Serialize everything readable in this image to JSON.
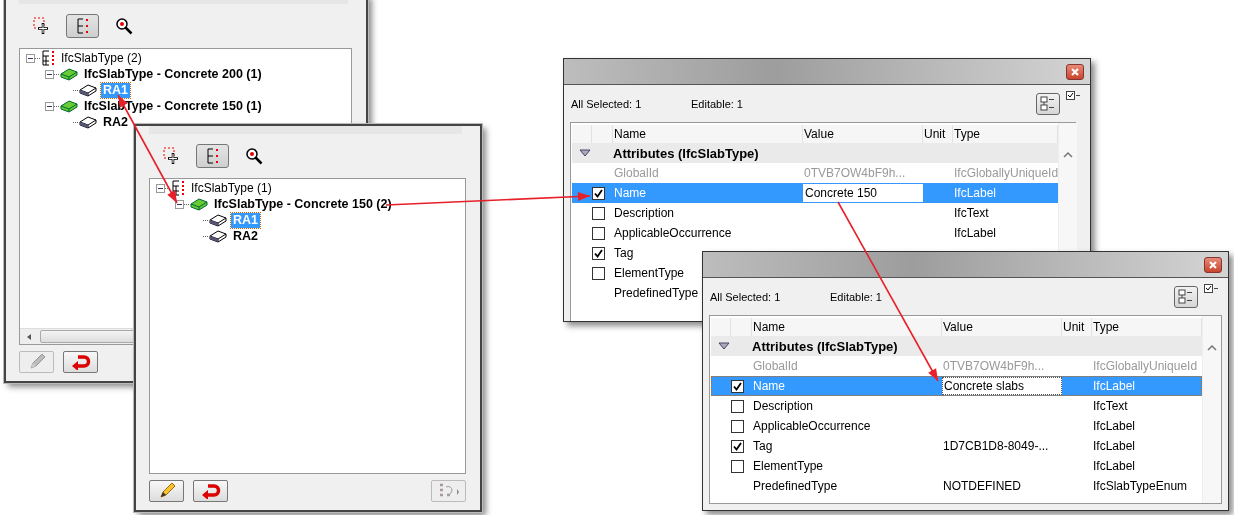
{
  "tree_panels": [
    {
      "toolbar": [
        {
          "kind": "select",
          "selected": false
        },
        {
          "kind": "tree",
          "selected": true
        },
        {
          "kind": "find",
          "selected": false
        }
      ],
      "tree": [
        {
          "label": "IfcSlabType (2)",
          "kind": "root",
          "expanded": true,
          "selected": false,
          "children": [
            {
              "label": "IfcSlabType - Concrete 200 (1)",
              "kind": "type",
              "expanded": true,
              "selected": false,
              "children": [
                {
                  "label": "RA1",
                  "kind": "item",
                  "selected": true
                }
              ]
            },
            {
              "label": "IfcSlabType - Concrete 150 (1)",
              "kind": "type",
              "expanded": true,
              "selected": false,
              "children": [
                {
                  "label": "RA2",
                  "kind": "item",
                  "selected": false
                }
              ]
            }
          ]
        }
      ],
      "buttons": [
        {
          "kind": "edit",
          "disabled": true
        },
        {
          "kind": "undo",
          "disabled": false
        }
      ]
    },
    {
      "toolbar": [
        {
          "kind": "select",
          "selected": false
        },
        {
          "kind": "tree",
          "selected": true
        },
        {
          "kind": "find",
          "selected": false
        }
      ],
      "tree": [
        {
          "label": "IfcSlabType (1)",
          "kind": "root",
          "expanded": true,
          "selected": false,
          "children": [
            {
              "label": "IfcSlabType - Concrete 150 (2)",
              "kind": "type",
              "expanded": true,
              "selected": false,
              "children": [
                {
                  "label": "RA1",
                  "kind": "item",
                  "selected": true
                },
                {
                  "label": "RA2",
                  "kind": "item",
                  "selected": false
                }
              ]
            }
          ]
        }
      ],
      "buttons": [
        {
          "kind": "edit",
          "disabled": false
        },
        {
          "kind": "undo",
          "disabled": false
        },
        {
          "kind": "move",
          "disabled": true
        }
      ]
    }
  ],
  "property_panels": [
    {
      "summary": [
        "All Selected: 1",
        "Editable: 1"
      ],
      "columns": [
        "Name",
        "Value",
        "Unit",
        "Type"
      ],
      "group": {
        "label": "Attributes (IfcSlabType)",
        "expanded": true
      },
      "rows": [
        {
          "name": "GlobalId",
          "kind": "plain",
          "disabled": true,
          "selected": false,
          "editing": false,
          "value": "0TVB7OW4bF9h...",
          "type": "IfcGloballyUniqueId"
        },
        {
          "name": "Name",
          "kind": "check",
          "checked": true,
          "disabled": false,
          "selected": true,
          "editing": true,
          "value": "Concrete 150",
          "type": "IfcLabel"
        },
        {
          "name": "Description",
          "kind": "check",
          "checked": false,
          "disabled": false,
          "selected": false,
          "editing": false,
          "type": "IfcText"
        },
        {
          "name": "ApplicableOccurrence",
          "kind": "check",
          "checked": false,
          "disabled": false,
          "selected": false,
          "editing": false,
          "type": "IfcLabel"
        },
        {
          "name": "Tag",
          "kind": "check",
          "checked": true,
          "disabled": false,
          "selected": false,
          "editing": false
        },
        {
          "name": "ElementType",
          "kind": "check",
          "checked": false,
          "disabled": false,
          "selected": false,
          "editing": false
        },
        {
          "name": "PredefinedType",
          "kind": "plain",
          "disabled": false,
          "selected": false,
          "editing": false
        }
      ]
    },
    {
      "summary": [
        "All Selected: 1",
        "Editable: 1"
      ],
      "columns": [
        "Name",
        "Value",
        "Unit",
        "Type"
      ],
      "group": {
        "label": "Attributes (IfcSlabType)",
        "expanded": true
      },
      "rows": [
        {
          "name": "GlobalId",
          "kind": "plain",
          "disabled": true,
          "selected": false,
          "editing": false,
          "value": "0TVB7OW4bF9h...",
          "type": "IfcGloballyUniqueId"
        },
        {
          "name": "Name",
          "kind": "check",
          "checked": true,
          "disabled": false,
          "selected": true,
          "editing": true,
          "value": "Concrete slabs",
          "type": "IfcLabel"
        },
        {
          "name": "Description",
          "kind": "check",
          "checked": false,
          "disabled": false,
          "selected": false,
          "editing": false,
          "type": "IfcText"
        },
        {
          "name": "ApplicableOccurrence",
          "kind": "check",
          "checked": false,
          "disabled": false,
          "selected": false,
          "editing": false,
          "type": "IfcLabel"
        },
        {
          "name": "Tag",
          "kind": "check",
          "checked": true,
          "disabled": false,
          "selected": false,
          "editing": false,
          "value": "1D7CB1D8-8049-...",
          "type": "IfcLabel"
        },
        {
          "name": "ElementType",
          "kind": "check",
          "checked": false,
          "disabled": false,
          "selected": false,
          "editing": false,
          "type": "IfcLabel"
        },
        {
          "name": "PredefinedType",
          "kind": "plain",
          "disabled": false,
          "selected": false,
          "editing": false,
          "value": "NOTDEFINED",
          "type": "IfcSlabTypeEnum"
        }
      ]
    }
  ]
}
